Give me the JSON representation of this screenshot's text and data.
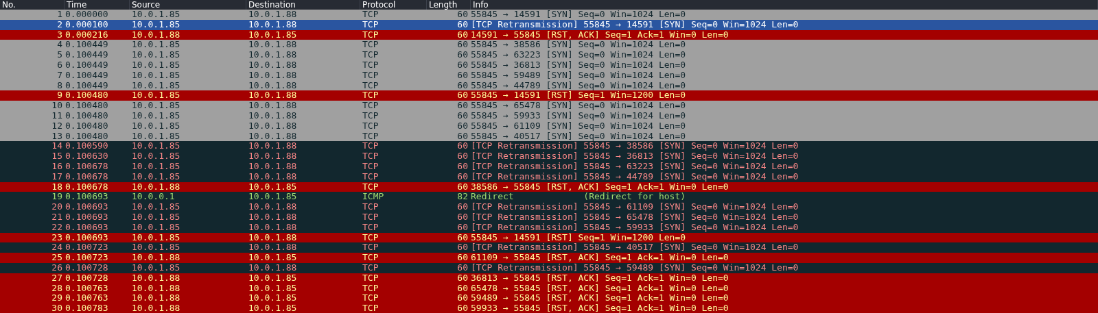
{
  "table": {
    "columns": [
      "No.",
      "Time",
      "Source",
      "Destination",
      "Protocol",
      "Length",
      "Info"
    ],
    "rows": [
      {
        "kind": "normal",
        "selected": false,
        "cells": [
          "1",
          "0.000000",
          "10.0.1.85",
          "10.0.1.88",
          "TCP",
          "60",
          "55845 → 14591 [SYN] Seq=0 Win=1024 Len=0"
        ]
      },
      {
        "kind": "retransmission",
        "selected": true,
        "cells": [
          "2",
          "0.000100",
          "10.0.1.85",
          "10.0.1.88",
          "TCP",
          "60",
          "[TCP Retransmission] 55845 → 14591 [SYN] Seq=0 Win=1024 Len=0"
        ]
      },
      {
        "kind": "reset",
        "selected": false,
        "cells": [
          "3",
          "0.000216",
          "10.0.1.88",
          "10.0.1.85",
          "TCP",
          "60",
          "14591 → 55845 [RST, ACK] Seq=1 Ack=1 Win=0 Len=0"
        ]
      },
      {
        "kind": "normal",
        "selected": false,
        "cells": [
          "4",
          "0.100449",
          "10.0.1.85",
          "10.0.1.88",
          "TCP",
          "60",
          "55845 → 38586 [SYN] Seq=0 Win=1024 Len=0"
        ]
      },
      {
        "kind": "normal",
        "selected": false,
        "cells": [
          "5",
          "0.100449",
          "10.0.1.85",
          "10.0.1.88",
          "TCP",
          "60",
          "55845 → 63223 [SYN] Seq=0 Win=1024 Len=0"
        ]
      },
      {
        "kind": "normal",
        "selected": false,
        "cells": [
          "6",
          "0.100449",
          "10.0.1.85",
          "10.0.1.88",
          "TCP",
          "60",
          "55845 → 36813 [SYN] Seq=0 Win=1024 Len=0"
        ]
      },
      {
        "kind": "normal",
        "selected": false,
        "cells": [
          "7",
          "0.100449",
          "10.0.1.85",
          "10.0.1.88",
          "TCP",
          "60",
          "55845 → 59489 [SYN] Seq=0 Win=1024 Len=0"
        ]
      },
      {
        "kind": "normal",
        "selected": false,
        "cells": [
          "8",
          "0.100449",
          "10.0.1.85",
          "10.0.1.88",
          "TCP",
          "60",
          "55845 → 44789 [SYN] Seq=0 Win=1024 Len=0"
        ]
      },
      {
        "kind": "reset",
        "selected": false,
        "cells": [
          "9",
          "0.100480",
          "10.0.1.85",
          "10.0.1.88",
          "TCP",
          "60",
          "55845 → 14591 [RST] Seq=1 Win=1200 Len=0"
        ]
      },
      {
        "kind": "normal",
        "selected": false,
        "cells": [
          "10",
          "0.100480",
          "10.0.1.85",
          "10.0.1.88",
          "TCP",
          "60",
          "55845 → 65478 [SYN] Seq=0 Win=1024 Len=0"
        ]
      },
      {
        "kind": "normal",
        "selected": false,
        "cells": [
          "11",
          "0.100480",
          "10.0.1.85",
          "10.0.1.88",
          "TCP",
          "60",
          "55845 → 59933 [SYN] Seq=0 Win=1024 Len=0"
        ]
      },
      {
        "kind": "normal",
        "selected": false,
        "cells": [
          "12",
          "0.100480",
          "10.0.1.85",
          "10.0.1.88",
          "TCP",
          "60",
          "55845 → 61109 [SYN] Seq=0 Win=1024 Len=0"
        ]
      },
      {
        "kind": "normal",
        "selected": false,
        "cells": [
          "13",
          "0.100480",
          "10.0.1.85",
          "10.0.1.88",
          "TCP",
          "60",
          "55845 → 40517 [SYN] Seq=0 Win=1024 Len=0"
        ]
      },
      {
        "kind": "retransmission",
        "selected": false,
        "cells": [
          "14",
          "0.100590",
          "10.0.1.85",
          "10.0.1.88",
          "TCP",
          "60",
          "[TCP Retransmission] 55845 → 38586 [SYN] Seq=0 Win=1024 Len=0"
        ]
      },
      {
        "kind": "retransmission",
        "selected": false,
        "cells": [
          "15",
          "0.100630",
          "10.0.1.85",
          "10.0.1.88",
          "TCP",
          "60",
          "[TCP Retransmission] 55845 → 36813 [SYN] Seq=0 Win=1024 Len=0"
        ]
      },
      {
        "kind": "retransmission",
        "selected": false,
        "cells": [
          "16",
          "0.100678",
          "10.0.1.85",
          "10.0.1.88",
          "TCP",
          "60",
          "[TCP Retransmission] 55845 → 63223 [SYN] Seq=0 Win=1024 Len=0"
        ]
      },
      {
        "kind": "retransmission",
        "selected": false,
        "cells": [
          "17",
          "0.100678",
          "10.0.1.85",
          "10.0.1.88",
          "TCP",
          "60",
          "[TCP Retransmission] 55845 → 44789 [SYN] Seq=0 Win=1024 Len=0"
        ]
      },
      {
        "kind": "reset",
        "selected": false,
        "cells": [
          "18",
          "0.100678",
          "10.0.1.88",
          "10.0.1.85",
          "TCP",
          "60",
          "38586 → 55845 [RST, ACK] Seq=1 Ack=1 Win=0 Len=0"
        ]
      },
      {
        "kind": "icmp",
        "selected": false,
        "cells": [
          "19",
          "0.100693",
          "10.0.0.1",
          "10.0.1.85",
          "ICMP",
          "82",
          "Redirect             (Redirect for host)"
        ]
      },
      {
        "kind": "retransmission",
        "selected": false,
        "cells": [
          "20",
          "0.100693",
          "10.0.1.85",
          "10.0.1.88",
          "TCP",
          "60",
          "[TCP Retransmission] 55845 → 61109 [SYN] Seq=0 Win=1024 Len=0"
        ]
      },
      {
        "kind": "retransmission",
        "selected": false,
        "cells": [
          "21",
          "0.100693",
          "10.0.1.85",
          "10.0.1.88",
          "TCP",
          "60",
          "[TCP Retransmission] 55845 → 65478 [SYN] Seq=0 Win=1024 Len=0"
        ]
      },
      {
        "kind": "retransmission",
        "selected": false,
        "cells": [
          "22",
          "0.100693",
          "10.0.1.85",
          "10.0.1.88",
          "TCP",
          "60",
          "[TCP Retransmission] 55845 → 59933 [SYN] Seq=0 Win=1024 Len=0"
        ]
      },
      {
        "kind": "reset",
        "selected": false,
        "cells": [
          "23",
          "0.100693",
          "10.0.1.85",
          "10.0.1.88",
          "TCP",
          "60",
          "55845 → 14591 [RST] Seq=1 Win=1200 Len=0"
        ]
      },
      {
        "kind": "retransmission",
        "selected": false,
        "cells": [
          "24",
          "0.100723",
          "10.0.1.85",
          "10.0.1.88",
          "TCP",
          "60",
          "[TCP Retransmission] 55845 → 40517 [SYN] Seq=0 Win=1024 Len=0"
        ]
      },
      {
        "kind": "reset",
        "selected": false,
        "cells": [
          "25",
          "0.100723",
          "10.0.1.88",
          "10.0.1.85",
          "TCP",
          "60",
          "61109 → 55845 [RST, ACK] Seq=1 Ack=1 Win=0 Len=0"
        ]
      },
      {
        "kind": "retransmission",
        "selected": false,
        "cells": [
          "26",
          "0.100728",
          "10.0.1.85",
          "10.0.1.88",
          "TCP",
          "60",
          "[TCP Retransmission] 55845 → 59489 [SYN] Seq=0 Win=1024 Len=0"
        ]
      },
      {
        "kind": "reset",
        "selected": false,
        "cells": [
          "27",
          "0.100728",
          "10.0.1.88",
          "10.0.1.85",
          "TCP",
          "60",
          "36813 → 55845 [RST, ACK] Seq=1 Ack=1 Win=0 Len=0"
        ]
      },
      {
        "kind": "reset",
        "selected": false,
        "cells": [
          "28",
          "0.100763",
          "10.0.1.88",
          "10.0.1.85",
          "TCP",
          "60",
          "65478 → 55845 [RST, ACK] Seq=1 Ack=1 Win=0 Len=0"
        ]
      },
      {
        "kind": "reset",
        "selected": false,
        "cells": [
          "29",
          "0.100763",
          "10.0.1.88",
          "10.0.1.85",
          "TCP",
          "60",
          "59489 → 55845 [RST, ACK] Seq=1 Ack=1 Win=0 Len=0"
        ]
      },
      {
        "kind": "reset",
        "selected": false,
        "cells": [
          "30",
          "0.100783",
          "10.0.1.88",
          "10.0.1.85",
          "TCP",
          "60",
          "59933 → 55845 [RST, ACK] Seq=1 Ack=1 Win=0 Len=0"
        ]
      }
    ]
  }
}
